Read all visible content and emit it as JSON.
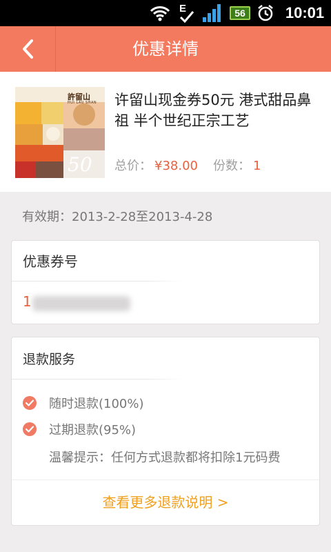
{
  "status_bar": {
    "network_type": "E",
    "battery_level": "56",
    "time": "10:01",
    "icons": [
      "wifi-icon",
      "edge-network-icon",
      "signal-icon",
      "battery-icon",
      "alarm-icon"
    ]
  },
  "header": {
    "title": "优惠详情",
    "back_icon": "chevron-left-icon",
    "color": "#f47a5f"
  },
  "product": {
    "title": "许留山现金券50元 港式甜品鼻祖 半个世纪正宗工艺",
    "image_brand": "許留山",
    "image_brand_en": "HUI LAU SHAN",
    "image_value": "50",
    "total_price_label": "总价：",
    "total_price_value": "¥38.00",
    "quantity_label": "份数：",
    "quantity_value": "1"
  },
  "validity": {
    "text": "有效期：2013-2-28至2013-4-28"
  },
  "coupon": {
    "header": "优惠券号",
    "code_visible": "1"
  },
  "refund": {
    "header": "退款服务",
    "items": [
      {
        "label": "随时退款(100%)"
      },
      {
        "label": "过期退款(95%)"
      }
    ],
    "tip": "温馨提示：任何方式退款都将扣除1元码费",
    "more_link": "查看更多退款说明 >"
  },
  "colors": {
    "accent": "#e8613f",
    "link": "#f0a020",
    "check": "#f07a63"
  }
}
